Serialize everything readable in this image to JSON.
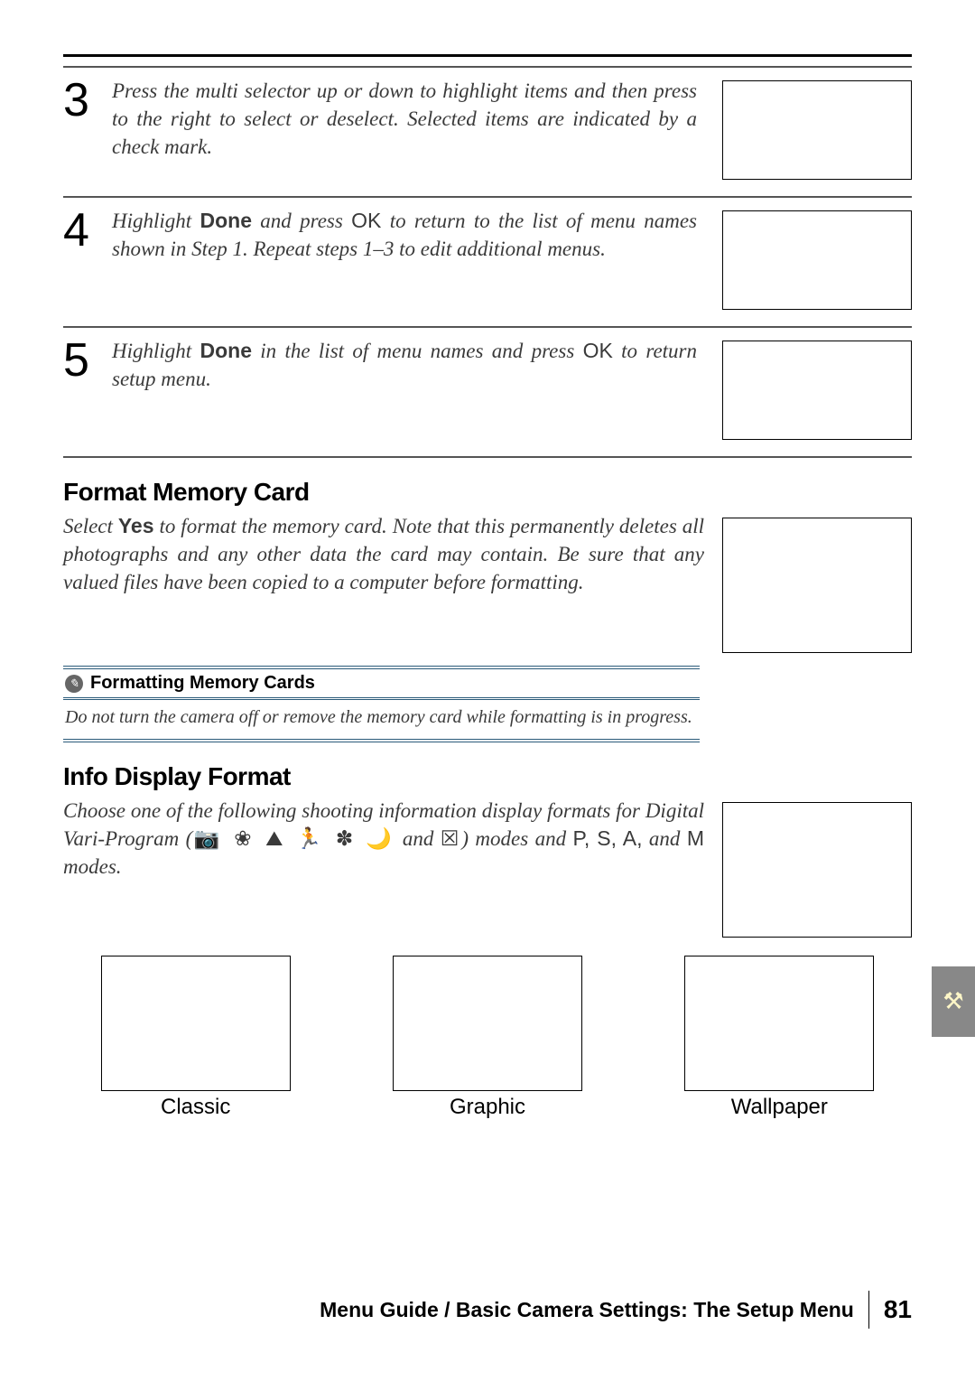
{
  "steps": [
    {
      "num": "3",
      "text_pre": "Press the multi selector up or down to highlight items and then press to the right to select or deselect.  Selected items are indicated by a check mark."
    },
    {
      "num": "4",
      "text_a": "Highlight ",
      "bold1": "Done",
      "text_b": " and press ",
      "sans1": "OK",
      "text_c": " to return to the list of menu names shown in Step 1.  Repeat   steps 1–3 to edit additional menus."
    },
    {
      "num": "5",
      "text_a": "Highlight ",
      "bold1": "Done",
      "text_b": " in the list of menu names and press    ",
      "sans1": "OK",
      "text_c": " to return setup menu."
    }
  ],
  "format_card": {
    "heading": "Format Memory Card",
    "body_a": "Select ",
    "bold": "Yes",
    "body_b": " to format the memory card.  Note that this permanently deletes all photographs and any other data the card may contain. Be sure that any valued files   have been copied to a computer before formatting."
  },
  "note": {
    "icon": "✎",
    "title": "Formatting Memory Cards",
    "body": "Do not turn the camera off or remove    the memory card while formatting is in progress."
  },
  "info_display": {
    "heading": "Info Display Format",
    "body_a": "Choose one of the following shooting information display formats for Digital Vari-Program (",
    "icons": "📷 ❀ ⛰ 🏃 ✽ 🌙",
    "body_b": " and ",
    "icon2": "☒",
    "body_c": ") modes and ",
    "modes": "P, S, A,",
    "body_d": " and ",
    "mode_m": "M",
    "body_e": " modes.",
    "formats": [
      {
        "label": "Classic"
      },
      {
        "label": "Graphic"
      },
      {
        "label": "Wallpaper"
      }
    ]
  },
  "side_tab": "⚒",
  "footer": {
    "title": "Menu Guide / Basic Camera Settings: The Setup Menu",
    "page": "81"
  }
}
